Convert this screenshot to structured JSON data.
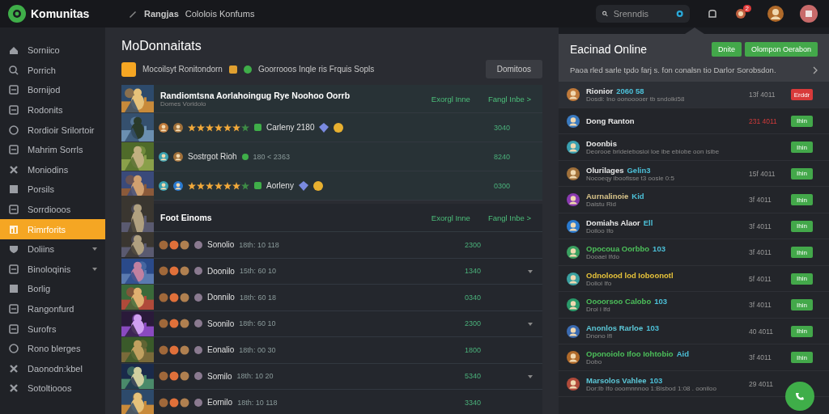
{
  "top_bar": {
    "app_name": "Komunitas",
    "breadcrumb": [
      "Rangjas",
      "Cololois Konfums"
    ],
    "search": {
      "placeholder": "Srenndis"
    },
    "notification_badge": "2"
  },
  "sidebar": {
    "items": [
      {
        "label": "Sorniico",
        "selected": false,
        "expandable": false
      },
      {
        "label": "Porrich",
        "selected": false,
        "expandable": false
      },
      {
        "label": "Bornijod",
        "selected": false,
        "expandable": false
      },
      {
        "label": "Rodonits",
        "selected": false,
        "expandable": false
      },
      {
        "label": "Rordioir Srilortoir",
        "selected": false,
        "expandable": false
      },
      {
        "label": "Mahrim Sorrls",
        "selected": false,
        "expandable": false
      },
      {
        "label": "Moniodins",
        "selected": false,
        "expandable": false
      },
      {
        "label": "Porsils",
        "selected": false,
        "expandable": false
      },
      {
        "label": "Sorrdiooos",
        "selected": false,
        "expandable": false
      },
      {
        "label": "Rimrforits",
        "selected": true,
        "expandable": false
      },
      {
        "label": "Doliins",
        "selected": false,
        "expandable": true
      },
      {
        "label": "Binoloqinis",
        "selected": false,
        "expandable": true
      },
      {
        "label": "Borlig",
        "selected": false,
        "expandable": false
      },
      {
        "label": "Rangonfurd",
        "selected": false,
        "expandable": false
      },
      {
        "label": "Surofrs",
        "selected": false,
        "expandable": false
      },
      {
        "label": "Rono blerges",
        "selected": false,
        "expandable": false
      },
      {
        "label": "Daonodn:kbel",
        "selected": false,
        "expandable": false
      },
      {
        "label": "Sotoltiooos",
        "selected": false,
        "expandable": false
      }
    ]
  },
  "main": {
    "title": "MoDonnaitats",
    "notice": {
      "text": "Mocoilsyt Ronitondorn",
      "detail": "Goorrooos Inqle ris Frquis Sopls",
      "button": "Domitoos"
    },
    "sections": [
      {
        "title": "Randiomtsna Aorlahoingug Rye Noohoo Oorrb",
        "subtitle": "Domes Voridolo",
        "links": [
          "Exorgl Inne",
          "Fangl Inbe >"
        ],
        "rows": [
          {
            "kind": "rated",
            "stars": 6,
            "label": "Carleny 2180",
            "value": "3040"
          },
          {
            "kind": "plain",
            "label": "Sostrgot Rioh",
            "detail": "180 < 2363",
            "value": "8240"
          },
          {
            "kind": "rated",
            "stars": 6,
            "label": "Aorleny",
            "value": "0300"
          }
        ]
      },
      {
        "title": "Foot Einoms",
        "links": [
          "Exorgl Inne",
          "Fangl Inbe >"
        ],
        "rows": [
          {
            "kind": "dated",
            "label": "Sonolio",
            "detail": "18th: 10 118",
            "value": "2300",
            "expandable": false
          },
          {
            "kind": "dated",
            "label": "Doonilo",
            "detail": "15th: 60 10",
            "value": "1340",
            "expandable": true
          },
          {
            "kind": "dated",
            "label": "Donnilo",
            "detail": "18th: 60 18",
            "value": "0340",
            "expandable": false
          },
          {
            "kind": "dated",
            "label": "Soonilo",
            "detail": "18th: 60 10",
            "value": "2300",
            "expandable": true
          },
          {
            "kind": "dated",
            "label": "Eonalio",
            "detail": "18th: 00 30",
            "value": "1800",
            "expandable": false
          },
          {
            "kind": "dated",
            "label": "Somilo",
            "detail": "18th: 10 20",
            "value": "5340",
            "expandable": true
          },
          {
            "kind": "dated",
            "label": "Eornilo",
            "detail": "18th: 10 118",
            "value": "3340",
            "expandable": false
          }
        ]
      }
    ]
  },
  "popup": {
    "title": "Eacinad Online",
    "buttons": [
      "Dnite",
      "Olompon Oerabon"
    ],
    "text": "Paoa rled sarle tpdo farj s. fon conalsn tio Darlor Sorobsdon.",
    "rows": [
      {
        "name": "Rionior",
        "tag": "2060 58",
        "color": "#e8e8e8",
        "sub": "Dosdi: Ino oonooooer tb sndolki58",
        "time": "13f 4011",
        "alert": false,
        "action": {
          "kind": "danger",
          "label": "Erddr"
        }
      },
      {
        "name": "Dong Ranton",
        "color": "#e8e8e8",
        "time": "231 4011",
        "alert": true,
        "action": {
          "kind": "ok",
          "label": "Ihin"
        }
      },
      {
        "name": "Doonbis",
        "color": "#e8e8e8",
        "sub": "Deorooe brideiebosioi loe ibe ebiobe oon isibe",
        "action": {
          "kind": "ok",
          "label": "Ihin"
        }
      },
      {
        "name": "Olurilages",
        "tag": "Gelin3",
        "color": "#e8e8e8",
        "sub": "Nocoeqy iboofisse t3 oosle 0:5",
        "time": "15f 4011",
        "alert": false,
        "action": {
          "kind": "ok",
          "label": "Ihin"
        }
      },
      {
        "name": "Aurnalinoie",
        "tag": "Kid",
        "color": "#d9c48a",
        "sub": "Daistu Rid",
        "time": "3f 4011",
        "alert": false,
        "action": {
          "kind": "ok",
          "label": "Ihin"
        }
      },
      {
        "name": "Domiahs Alaor",
        "tag": "Ell",
        "color": "#e8e8e8",
        "sub": "Doiloo Ifo",
        "time": "3f 4011",
        "alert": false,
        "action": {
          "kind": "ok",
          "label": "Ihin"
        }
      },
      {
        "name": "Opocoua Oorbbo",
        "tag": "103",
        "color": "#4cbf5a",
        "sub": "Dooaei Ifdo",
        "time": "3f 4011",
        "alert": false,
        "action": {
          "kind": "ok",
          "label": "Ihin"
        }
      },
      {
        "name": "Odnolood lod Ioboonotl",
        "color": "#e6c23a",
        "sub": "Dolioi Ifo",
        "time": "5f 4011",
        "alert": false,
        "action": {
          "kind": "ok",
          "label": "Ihin"
        }
      },
      {
        "name": "Oooorsoo Calobo",
        "tag": "103",
        "color": "#4cbf5a",
        "sub": "Droi i Ifd",
        "time": "3f 4011",
        "alert": false,
        "action": {
          "kind": "ok",
          "label": "Ihin"
        }
      },
      {
        "name": "Anonlos Rarloe",
        "tag": "103",
        "color": "#5cc8d8",
        "sub": "Dnono Ifl",
        "time": "40 4011",
        "alert": false,
        "action": {
          "kind": "ok",
          "label": "Ihin"
        }
      },
      {
        "name": "Oponoiolo Ifoo Iohtobio",
        "tag": "Aid",
        "color": "#4cbf5a",
        "sub": "Dobo",
        "time": "3f 4011",
        "alert": false,
        "action": {
          "kind": "ok",
          "label": "Ihin"
        }
      },
      {
        "name": "Marsolos Vahlee",
        "tag": "103",
        "color": "#5cc8d8",
        "sub": "Dor:Ib Ifo ooomnnnoo 1:Bisbod 1:08 . ooniloo",
        "time": "29 4011",
        "alert": false
      }
    ]
  }
}
